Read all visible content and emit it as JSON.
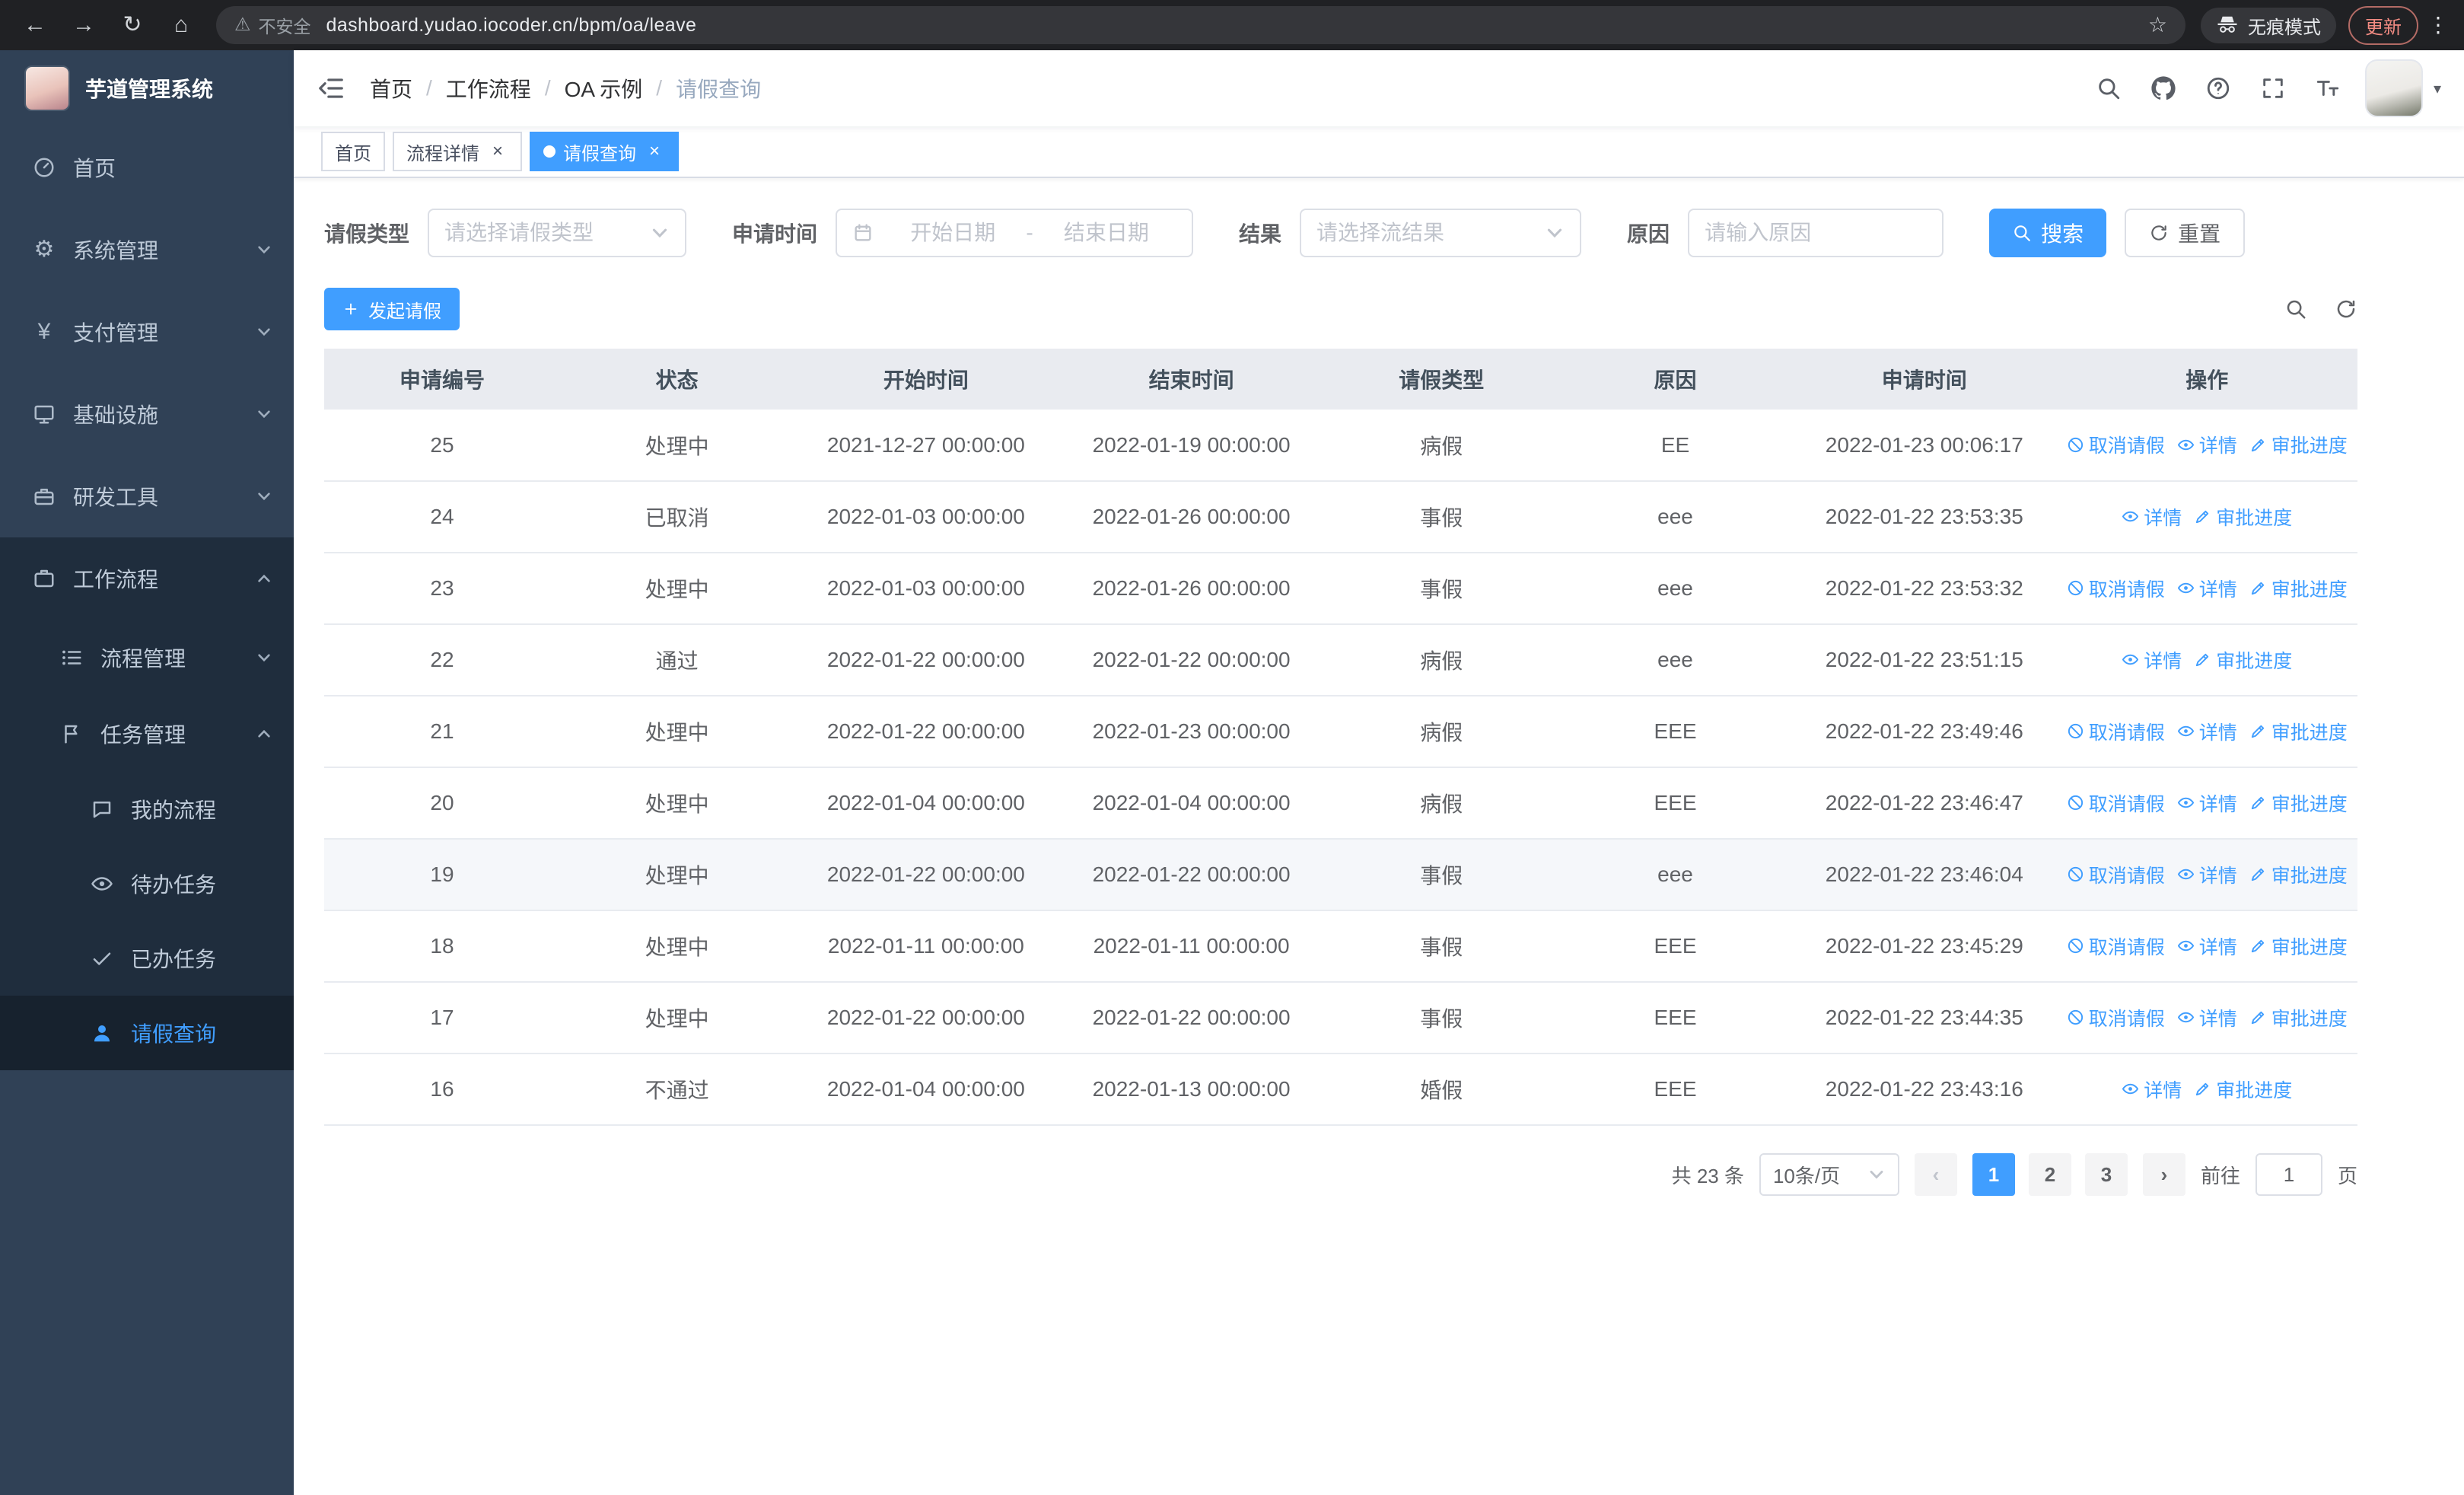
{
  "browser": {
    "nav_icons": [
      "back-icon",
      "forward-icon",
      "reload-icon",
      "home-icon"
    ],
    "security_label": "不安全",
    "url": "dashboard.yudao.iocoder.cn/bpm/oa/leave",
    "incognito_label": "无痕模式",
    "update_label": "更新"
  },
  "app_title": "芋道管理系统",
  "header": {
    "breadcrumb": [
      "首页",
      "工作流程",
      "OA 示例",
      "请假查询"
    ],
    "icons": [
      "search-icon",
      "github-icon",
      "help-icon",
      "fullscreen-icon",
      "font-size-icon"
    ]
  },
  "tabs": [
    {
      "label": "首页",
      "active": false,
      "closable": false
    },
    {
      "label": "流程详情",
      "active": false,
      "closable": true
    },
    {
      "label": "请假查询",
      "active": true,
      "closable": true
    }
  ],
  "sidebar": {
    "menu": [
      {
        "key": "home",
        "label": "首页",
        "icon": "dashboard-icon"
      },
      {
        "key": "system",
        "label": "系统管理",
        "icon": "gear-icon",
        "collapsible": true
      },
      {
        "key": "payment",
        "label": "支付管理",
        "icon": "yen-icon",
        "collapsible": true
      },
      {
        "key": "infra",
        "label": "基础设施",
        "icon": "monitor-icon",
        "collapsible": true
      },
      {
        "key": "devtools",
        "label": "研发工具",
        "icon": "toolbox-icon",
        "collapsible": true
      },
      {
        "key": "workflow",
        "label": "工作流程",
        "icon": "briefcase-icon",
        "collapsible": true,
        "expanded": true,
        "children": [
          {
            "key": "process-mgmt",
            "label": "流程管理",
            "icon": "list-icon",
            "collapsible": true
          },
          {
            "key": "task-mgmt",
            "label": "任务管理",
            "icon": "flag-icon",
            "collapsible": true,
            "expanded": true,
            "children": [
              {
                "key": "my-process",
                "label": "我的流程",
                "icon": "chat-icon"
              },
              {
                "key": "todo-task",
                "label": "待办任务",
                "icon": "eye-icon"
              },
              {
                "key": "done-task",
                "label": "已办任务",
                "icon": "check-icon"
              },
              {
                "key": "leave-query",
                "label": "请假查询",
                "icon": "user-icon",
                "active": true
              }
            ]
          }
        ]
      }
    ]
  },
  "filter": {
    "leave_type": {
      "label": "请假类型",
      "placeholder": "请选择请假类型"
    },
    "apply_time": {
      "label": "申请时间",
      "start_placeholder": "开始日期",
      "separator": "-",
      "end_placeholder": "结束日期"
    },
    "result": {
      "label": "结果",
      "placeholder": "请选择流结果"
    },
    "reason": {
      "label": "原因",
      "placeholder": "请输入原因"
    },
    "search_label": "搜索",
    "reset_label": "重置"
  },
  "toolbar": {
    "create_label": "发起请假"
  },
  "table": {
    "columns": [
      "申请编号",
      "状态",
      "开始时间",
      "结束时间",
      "请假类型",
      "原因",
      "申请时间",
      "操作"
    ],
    "action_defs": {
      "cancel": {
        "label": "取消请假",
        "icon": "cancel-icon"
      },
      "detail": {
        "label": "详情",
        "icon": "eye-icon"
      },
      "progress": {
        "label": "审批进度",
        "icon": "edit-icon"
      }
    },
    "rows": [
      {
        "id": "25",
        "status": "处理中",
        "start_time": "2021-12-27 00:00:00",
        "end_time": "2022-01-19 00:00:00",
        "leave_type": "病假",
        "reason": "EE",
        "apply_time": "2022-01-23 00:06:17",
        "actions": [
          "cancel",
          "detail",
          "progress"
        ],
        "highlight": false
      },
      {
        "id": "24",
        "status": "已取消",
        "start_time": "2022-01-03 00:00:00",
        "end_time": "2022-01-26 00:00:00",
        "leave_type": "事假",
        "reason": "eee",
        "apply_time": "2022-01-22 23:53:35",
        "actions": [
          "detail",
          "progress"
        ],
        "highlight": false
      },
      {
        "id": "23",
        "status": "处理中",
        "start_time": "2022-01-03 00:00:00",
        "end_time": "2022-01-26 00:00:00",
        "leave_type": "事假",
        "reason": "eee",
        "apply_time": "2022-01-22 23:53:32",
        "actions": [
          "cancel",
          "detail",
          "progress"
        ],
        "highlight": false
      },
      {
        "id": "22",
        "status": "通过",
        "start_time": "2022-01-22 00:00:00",
        "end_time": "2022-01-22 00:00:00",
        "leave_type": "病假",
        "reason": "eee",
        "apply_time": "2022-01-22 23:51:15",
        "actions": [
          "detail",
          "progress"
        ],
        "highlight": false
      },
      {
        "id": "21",
        "status": "处理中",
        "start_time": "2022-01-22 00:00:00",
        "end_time": "2022-01-23 00:00:00",
        "leave_type": "病假",
        "reason": "EEE",
        "apply_time": "2022-01-22 23:49:46",
        "actions": [
          "cancel",
          "detail",
          "progress"
        ],
        "highlight": false
      },
      {
        "id": "20",
        "status": "处理中",
        "start_time": "2022-01-04 00:00:00",
        "end_time": "2022-01-04 00:00:00",
        "leave_type": "病假",
        "reason": "EEE",
        "apply_time": "2022-01-22 23:46:47",
        "actions": [
          "cancel",
          "detail",
          "progress"
        ],
        "highlight": false
      },
      {
        "id": "19",
        "status": "处理中",
        "start_time": "2022-01-22 00:00:00",
        "end_time": "2022-01-22 00:00:00",
        "leave_type": "事假",
        "reason": "eee",
        "apply_time": "2022-01-22 23:46:04",
        "actions": [
          "cancel",
          "detail",
          "progress"
        ],
        "highlight": true
      },
      {
        "id": "18",
        "status": "处理中",
        "start_time": "2022-01-11 00:00:00",
        "end_time": "2022-01-11 00:00:00",
        "leave_type": "事假",
        "reason": "EEE",
        "apply_time": "2022-01-22 23:45:29",
        "actions": [
          "cancel",
          "detail",
          "progress"
        ],
        "highlight": false
      },
      {
        "id": "17",
        "status": "处理中",
        "start_time": "2022-01-22 00:00:00",
        "end_time": "2022-01-22 00:00:00",
        "leave_type": "事假",
        "reason": "EEE",
        "apply_time": "2022-01-22 23:44:35",
        "actions": [
          "cancel",
          "detail",
          "progress"
        ],
        "highlight": false
      },
      {
        "id": "16",
        "status": "不通过",
        "start_time": "2022-01-04 00:00:00",
        "end_time": "2022-01-13 00:00:00",
        "leave_type": "婚假",
        "reason": "EEE",
        "apply_time": "2022-01-22 23:43:16",
        "actions": [
          "detail",
          "progress"
        ],
        "highlight": false
      }
    ]
  },
  "pagination": {
    "total_label": "共 23 条",
    "page_size": "10条/页",
    "pages": [
      "1",
      "2",
      "3"
    ],
    "active_page": "1",
    "prev_icon": "chevron-left-icon",
    "next_icon": "chevron-right-icon",
    "goto_label": "前往",
    "goto_value": "1",
    "goto_suffix": "页"
  },
  "colors": {
    "accent": "#409EFF",
    "sidebar_bg": "#304156",
    "submenu_bg": "#1F2D3D"
  }
}
